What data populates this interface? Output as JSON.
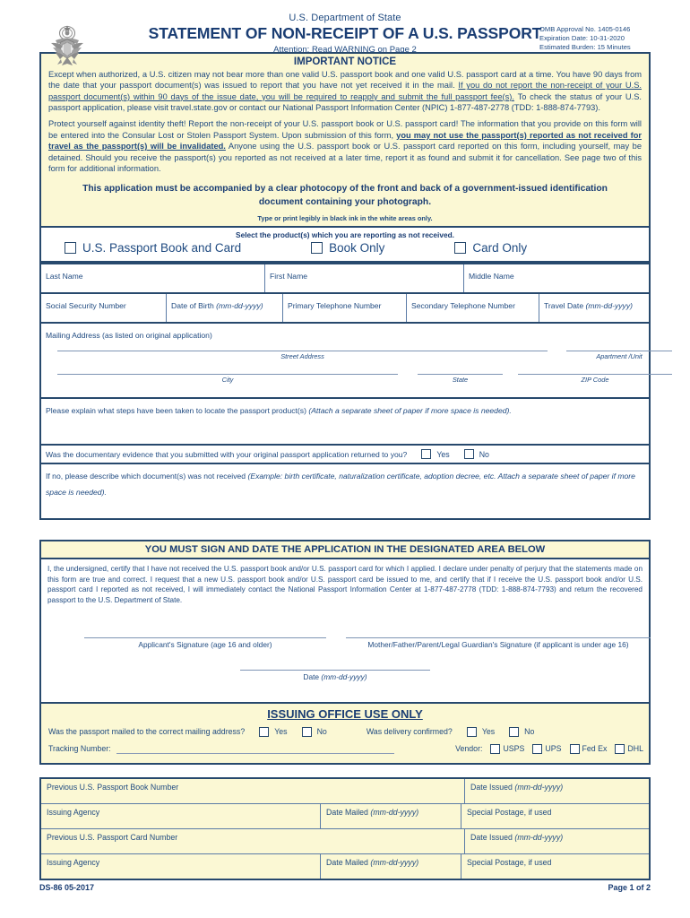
{
  "header": {
    "seal_icon": "us-department-of-state-seal",
    "department": "U.S. Department of State",
    "title": "STATEMENT OF NON-RECEIPT OF A U.S. PASSPORT",
    "attention": "Attention: Read WARNING on Page 2",
    "omb_approval": "OMB Approval No. 1405-0146",
    "omb_expiration": "Expiration Date: 10-31-2020",
    "omb_burden": "Estimated Burden:  15 Minutes"
  },
  "notice": {
    "title": "IMPORTANT NOTICE",
    "para1_a": "Except when authorized, a U.S. citizen may not bear more than one valid U.S. passport book and one valid U.S. passport card at a time. You have 90 days from the date that your passport document(s) was issued to report that you have not yet received it in the mail. ",
    "para1_underline": "If you do not report the non-receipt of your U.S. passport document(s) within 90 days of the issue date, you will be required to reapply and submit the full passport fee(s).",
    "para1_b": " To check the status of your U.S. passport application, please visit travel.state.gov or contact our National Passport Information Center (NPIC) 1-877-487-2778 (TDD: 1-888-874-7793).",
    "para2_a": "Protect yourself against identity theft! Report the non-receipt of your U.S. passport book or U.S. passport card!  The information that you provide on this form will be entered into the Consular Lost or Stolen Passport System. Upon submission of this form, ",
    "para2_bold": "you may not use the passport(s) reported as not received for travel as the passport(s) will be invalidated.",
    "para2_b": " Anyone using the U.S. passport book or U.S. passport card reported on this form, including yourself, may be detained. Should you receive the passport(s) you reported as not received at a later time, report it as found and submit it for cancellation. See page two of this form for additional information.",
    "accompany_line1": "This application must be accompanied by a clear photocopy of the front and back of a government-issued identification",
    "accompany_line2": "document containing your photograph.",
    "type_print": "Type or print legibly in black ink in the white areas only."
  },
  "product_select": {
    "instruction": "Select the product(s) which you are reporting as not received.",
    "options": [
      {
        "label": "U.S. Passport Book and Card"
      },
      {
        "label": "Book Only"
      },
      {
        "label": "Card Only"
      }
    ]
  },
  "name_fields": [
    {
      "label": "Last Name"
    },
    {
      "label": "First Name"
    },
    {
      "label": "Middle Name"
    }
  ],
  "detail_fields": [
    {
      "label": "Social Security Number",
      "hint": ""
    },
    {
      "label": "Date of Birth ",
      "hint": "(mm-dd-yyyy)"
    },
    {
      "label": "Primary Telephone Number",
      "hint": ""
    },
    {
      "label": "Secondary Telephone Number",
      "hint": ""
    },
    {
      "label": "Travel Date ",
      "hint": "(mm-dd-yyyy)"
    }
  ],
  "mailing_address": {
    "label": "Mailing Address (as listed on original application)",
    "street_caption": "Street Address",
    "apartment_caption": "Apartment /Unit",
    "city_caption": "City",
    "state_caption": "State",
    "zip_caption": "ZIP Code"
  },
  "explain": {
    "label_plain": "Please explain what steps have been taken to locate the passport product(s) ",
    "label_italic": "(Attach a separate sheet of paper if more space is needed)."
  },
  "evidence": {
    "question": "Was the documentary evidence that you submitted with your original passport application returned to you?",
    "yes": "Yes",
    "no": "No",
    "ifno_plain": "If no, please describe which document(s) was not received ",
    "ifno_italic": "(Example: birth certificate, naturalization certificate, adoption decree, etc. Attach a separate sheet of paper if more space is needed)."
  },
  "signature_section": {
    "banner": "YOU MUST SIGN AND DATE THE APPLICATION IN THE DESIGNATED AREA BELOW",
    "certification": "I, the undersigned, certify that I have not received the U.S. passport book and/or U.S. passport card for which I applied.  I declare under penalty of perjury that the statements made on this form are true and correct. I request that a new U.S. passport book and/or U.S. passport card be issued to me, and certify that if I receive the U.S. passport book and/or U.S. passport card I reported as not received, I will immediately contact the National Passport Information Center at 1-877-487-2778 (TDD: 1-888-874-7793) and return the recovered passport to the U.S. Department of State.",
    "applicant_caption": "Applicant's Signature  (age 16 and older)",
    "guardian_caption": "Mother/Father/Parent/Legal Guardian's Signature (if applicant is under age 16)",
    "date_caption_plain": "Date ",
    "date_caption_italic": "(mm-dd-yyyy)"
  },
  "issuing_office": {
    "title": "ISSUING OFFICE USE ONLY",
    "mailed_question": "Was the passport mailed to the correct mailing address?",
    "mailed_yes": "Yes",
    "mailed_no": "No",
    "delivery_question": "Was delivery confirmed?",
    "delivery_yes": "Yes",
    "delivery_no": "No",
    "tracking_label": "Tracking Number:",
    "tracking_value": "",
    "vendor_label": "Vendor:",
    "vendors": [
      {
        "label": "USPS"
      },
      {
        "label": "UPS"
      },
      {
        "label": "Fed Ex"
      },
      {
        "label": "DHL"
      }
    ]
  },
  "bottom_table": {
    "rows": [
      {
        "c1_plain": "Previous U.S. Passport Book Number",
        "c1_italic": "",
        "c2_plain": "",
        "c2_italic": "",
        "c3_plain": "Date Issued ",
        "c3_italic": "(mm-dd-yyyy)",
        "split": false
      },
      {
        "c1_plain": "Issuing Agency",
        "c1_italic": "",
        "c2_plain": "Date Mailed ",
        "c2_italic": "(mm-dd-yyyy)",
        "c3_plain": "Special Postage, if used",
        "c3_italic": "",
        "split": true
      },
      {
        "c1_plain": "Previous U.S. Passport Card Number",
        "c1_italic": "",
        "c2_plain": "",
        "c2_italic": "",
        "c3_plain": "Date Issued ",
        "c3_italic": "(mm-dd-yyyy)",
        "split": false
      },
      {
        "c1_plain": "Issuing Agency",
        "c1_italic": "",
        "c2_plain": "Date Mailed ",
        "c2_italic": "(mm-dd-yyyy)",
        "c3_plain": "Special Postage, if used",
        "c3_italic": "",
        "split": true
      }
    ]
  },
  "footer": {
    "form_number": "DS-86 05-2017",
    "page": "Page 1 of 2"
  },
  "colors": {
    "ink": "#1f4a80",
    "border": "#27496d",
    "paper_yellow": "#fbf8d4",
    "paper_white": "#ffffff"
  }
}
